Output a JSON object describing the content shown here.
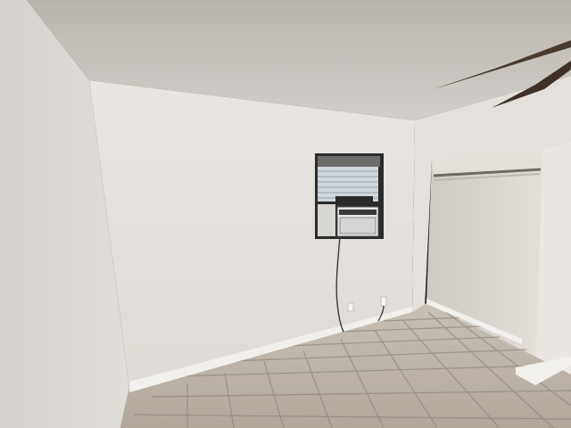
{
  "scene": {
    "subject": "empty-room-interior",
    "colors": {
      "ceiling": "#c8c3bd",
      "left_wall": "#dcd8d3",
      "back_wall": "#e6e3df",
      "right_wall": "#e4e1dd",
      "closet_interior": "#d9d5cf",
      "closet_shelf": "#6e6a66",
      "floor_tile": "#bdb3a8",
      "grout": "#8f867c",
      "baseboard": "#f2f0ec",
      "fan_blade": "#4a3a2e",
      "window_frame": "#2b2b2b",
      "window_glass": "#cfd6de",
      "ac_unit": "#e7e7e7",
      "cord": "#3a3a3a"
    },
    "items": [
      "ceiling",
      "left-wall",
      "back-wall",
      "closet",
      "ceiling-fan",
      "window",
      "air-conditioner",
      "power-cord",
      "outlet",
      "tile-floor",
      "baseboard"
    ]
  }
}
